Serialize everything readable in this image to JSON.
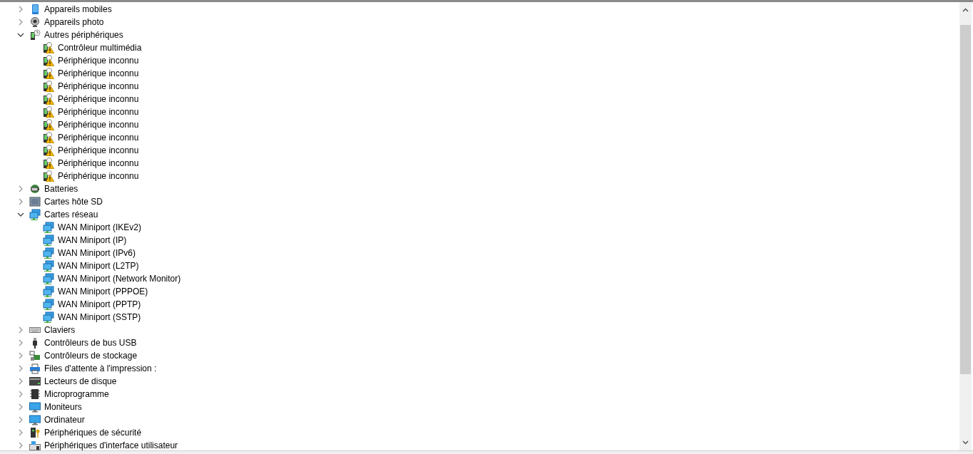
{
  "device_tree": [
    {
      "label": "Appareils mobiles",
      "kind": "mobile",
      "expanded": false
    },
    {
      "label": "Appareils photo",
      "kind": "camera",
      "expanded": false
    },
    {
      "label": "Autres périphériques",
      "kind": "unknown",
      "expanded": true,
      "children": [
        {
          "label": "Contrôleur multimédia",
          "kind": "warning"
        },
        {
          "label": "Périphérique inconnu",
          "kind": "warning"
        },
        {
          "label": "Périphérique inconnu",
          "kind": "warning"
        },
        {
          "label": "Périphérique inconnu",
          "kind": "warning"
        },
        {
          "label": "Périphérique inconnu",
          "kind": "warning"
        },
        {
          "label": "Périphérique inconnu",
          "kind": "warning"
        },
        {
          "label": "Périphérique inconnu",
          "kind": "warning"
        },
        {
          "label": "Périphérique inconnu",
          "kind": "warning"
        },
        {
          "label": "Périphérique inconnu",
          "kind": "warning"
        },
        {
          "label": "Périphérique inconnu",
          "kind": "warning"
        },
        {
          "label": "Périphérique inconnu",
          "kind": "warning"
        }
      ]
    },
    {
      "label": "Batteries",
      "kind": "battery",
      "expanded": false
    },
    {
      "label": "Cartes hôte SD",
      "kind": "sdcard",
      "expanded": false
    },
    {
      "label": "Cartes réseau",
      "kind": "network",
      "expanded": true,
      "children": [
        {
          "label": "WAN Miniport (IKEv2)",
          "kind": "network"
        },
        {
          "label": "WAN Miniport (IP)",
          "kind": "network"
        },
        {
          "label": "WAN Miniport (IPv6)",
          "kind": "network"
        },
        {
          "label": "WAN Miniport (L2TP)",
          "kind": "network"
        },
        {
          "label": "WAN Miniport (Network Monitor)",
          "kind": "network"
        },
        {
          "label": "WAN Miniport (PPPOE)",
          "kind": "network"
        },
        {
          "label": "WAN Miniport (PPTP)",
          "kind": "network"
        },
        {
          "label": "WAN Miniport (SSTP)",
          "kind": "network"
        }
      ]
    },
    {
      "label": "Claviers",
      "kind": "keyboard",
      "expanded": false
    },
    {
      "label": "Contrôleurs de bus USB",
      "kind": "usb",
      "expanded": false
    },
    {
      "label": "Contrôleurs de stockage",
      "kind": "storage",
      "expanded": false
    },
    {
      "label": "Files d'attente à l'impression :",
      "kind": "printer",
      "expanded": false
    },
    {
      "label": "Lecteurs de disque",
      "kind": "disk",
      "expanded": false
    },
    {
      "label": "Microprogramme",
      "kind": "chip",
      "expanded": false
    },
    {
      "label": "Moniteurs",
      "kind": "monitor",
      "expanded": false
    },
    {
      "label": "Ordinateur",
      "kind": "monitor",
      "expanded": false
    },
    {
      "label": "Périphériques de sécurité",
      "kind": "security",
      "expanded": false
    },
    {
      "label": "Périphériques d'interface utilisateur",
      "kind": "hid",
      "expanded": false
    }
  ]
}
